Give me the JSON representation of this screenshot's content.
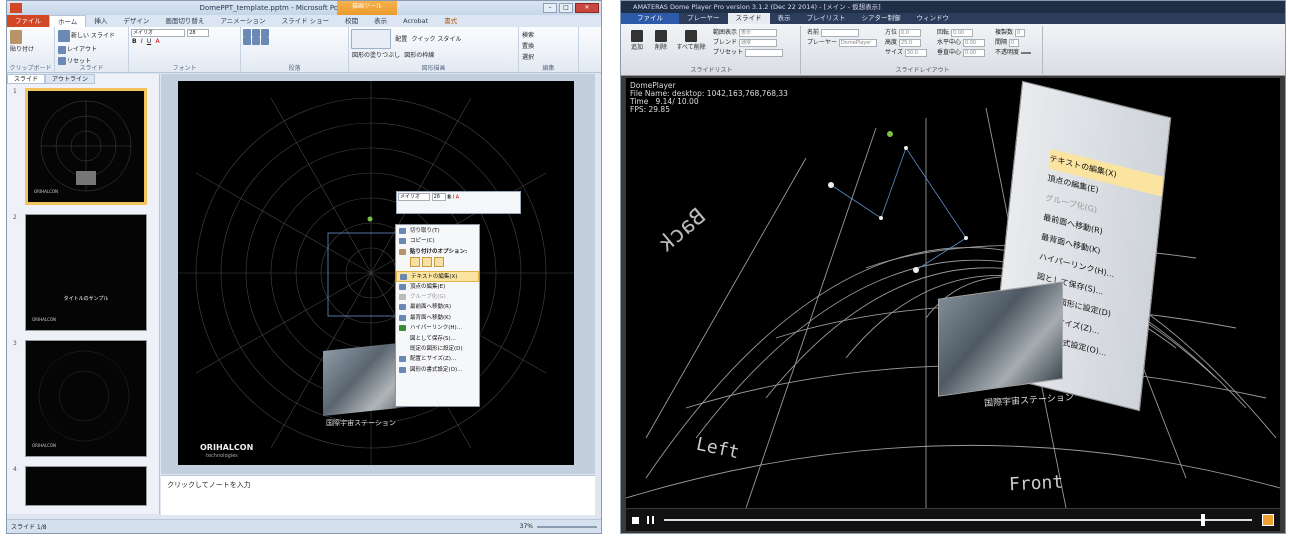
{
  "ppt": {
    "title": "DomePPT_template.pptm - Microsoft PowerPoint",
    "context_tab": "描画ツール",
    "context_sub": "書式",
    "tabs": [
      "ファイル",
      "ホーム",
      "挿入",
      "デザイン",
      "画面切り替え",
      "アニメーション",
      "スライド ショー",
      "校閲",
      "表示",
      "Acrobat",
      "書式"
    ],
    "ribbon": {
      "clipboard": {
        "paste": "貼り付け",
        "group": "クリップボード"
      },
      "slides": {
        "new": "新しい スライド",
        "layout": "レイアウト",
        "reset": "リセット",
        "section": "セクション",
        "group": "スライド"
      },
      "font": {
        "name": "メイリオ",
        "size": "28",
        "group": "フォント"
      },
      "paragraph": {
        "group": "段落"
      },
      "drawing": {
        "arrange": "配置",
        "quick": "クイック スタイル",
        "fill": "図形の塗りつぶし",
        "outline": "図形の枠線",
        "effects": "図形の効果",
        "group": "図形描画"
      },
      "editing": {
        "find": "検索",
        "replace": "置換",
        "select": "選択",
        "group": "編集"
      }
    },
    "panel_tabs": [
      "スライド",
      "アウトライン"
    ],
    "thumbs": [
      {
        "num": "1",
        "caption": ""
      },
      {
        "num": "2",
        "caption": "タイトルのサンプル"
      },
      {
        "num": "3",
        "caption": ""
      },
      {
        "num": "4",
        "caption": ""
      }
    ],
    "slide": {
      "logo": "ORIHALCON",
      "logo_sub": "technologies",
      "image_caption": "国際宇宙ステーション"
    },
    "minitoolbar": {
      "font": "メイリオ",
      "size": "28"
    },
    "context_menu": [
      {
        "label": "切り取り(T)",
        "state": ""
      },
      {
        "label": "コピー(C)",
        "state": ""
      },
      {
        "label": "貼り付けのオプション:",
        "state": "bold"
      },
      {
        "label": "",
        "state": "paste"
      },
      {
        "label": "テキストの編集(X)",
        "state": "hl"
      },
      {
        "label": "頂点の編集(E)",
        "state": ""
      },
      {
        "label": "グループ化(G)",
        "state": "dis"
      },
      {
        "label": "最前面へ移動(R)",
        "state": ""
      },
      {
        "label": "最背面へ移動(K)",
        "state": ""
      },
      {
        "label": "ハイパーリンク(H)...",
        "state": ""
      },
      {
        "label": "図として保存(S)...",
        "state": ""
      },
      {
        "label": "既定の図形に設定(D)",
        "state": ""
      },
      {
        "label": "配置とサイズ(Z)...",
        "state": ""
      },
      {
        "label": "図形の書式設定(O)...",
        "state": ""
      }
    ],
    "notes": "クリックしてノートを入力",
    "status": {
      "slide": "スライド 1/8",
      "zoom": "37%"
    }
  },
  "dome": {
    "title": "AMATERAS Dome Player Pro version 3.1.2 (Dec 22 2014) - [メイン - 仮想表示]",
    "tabs": [
      "ファイル",
      "プレーヤー",
      "スライド",
      "表示",
      "プレイリスト",
      "シアター制御",
      "ウィンドウ"
    ],
    "ribbon": {
      "list_buttons": [
        "追加",
        "削除",
        "すべて削除"
      ],
      "fields1": [
        {
          "label": "範囲表示",
          "value": "表示"
        },
        {
          "label": "ブレンド",
          "value": "通常"
        },
        {
          "label": "プリセット",
          "value": ""
        }
      ],
      "group1": "スライドリスト",
      "name_label": "名前",
      "player_label": "プレーヤー",
      "player_value": "DomePlayer",
      "layout": [
        {
          "label": "方位",
          "value": "0.0"
        },
        {
          "label": "高度",
          "value": "25.0"
        },
        {
          "label": "サイズ",
          "value": "30.0"
        }
      ],
      "layout2": [
        {
          "label": "回転",
          "value": "0.00"
        },
        {
          "label": "水平中心",
          "value": "0.00"
        },
        {
          "label": "垂直中心",
          "value": "0.00"
        }
      ],
      "layout3": [
        {
          "label": "複製数",
          "value": "0"
        },
        {
          "label": "間隔",
          "value": "0"
        },
        {
          "label": "不透明度",
          "value": ""
        }
      ],
      "group2": "スライドレイアウト"
    },
    "info": "DomePlayer\nFile Name: desktop: 1042,163,768,768,33\nTime   9.14/ 10.00\nFPS: 29.85",
    "directions": {
      "back": "Back",
      "left": "Left",
      "front": "Front"
    },
    "caption": "国際宇宙ステーション",
    "menu_items": [
      "テキストの編集(X)",
      "頂点の編集(E)",
      "グループ化(G)",
      "最前面へ移動(R)",
      "最背面へ移動(K)",
      "ハイパーリンク(H)...",
      "図として保存(S)...",
      "既定の図形に設定(D)",
      "配置とサイズ(Z)...",
      "図形の書式設定(O)..."
    ],
    "progress": 0.914
  }
}
